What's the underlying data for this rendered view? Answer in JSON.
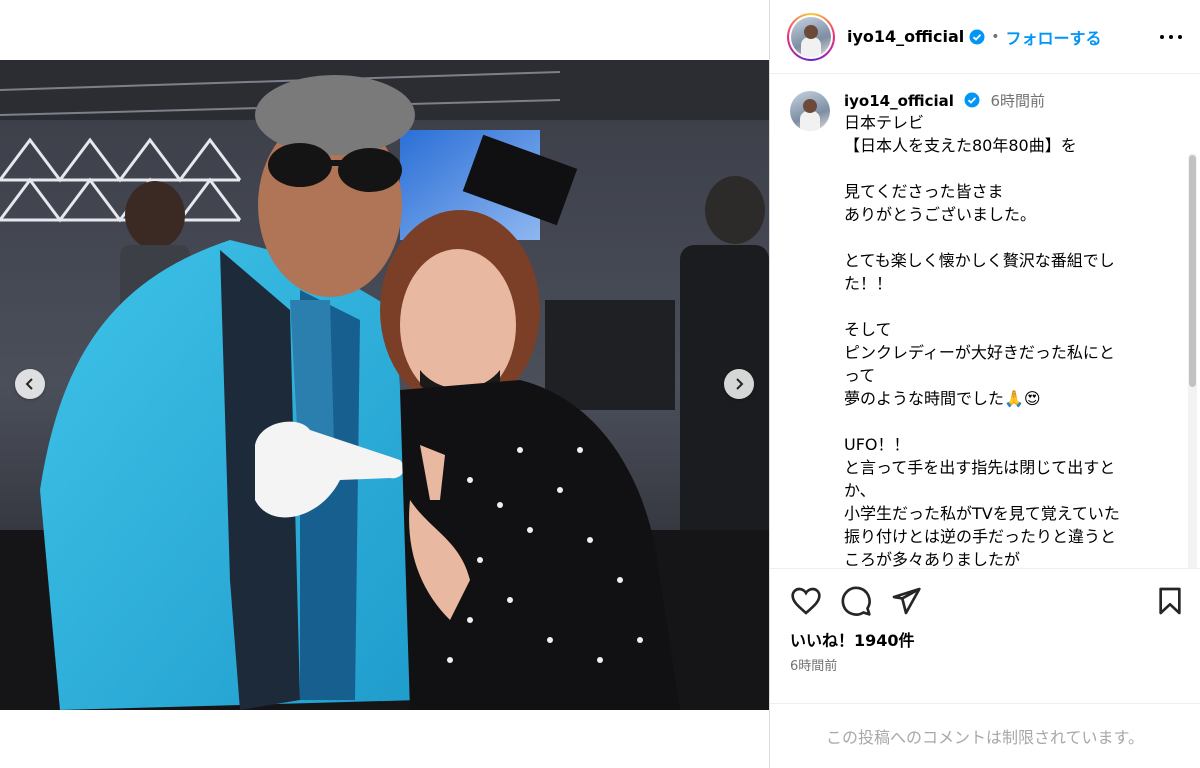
{
  "post": {
    "username": "iyo14_official",
    "follow_label": "フォローする",
    "separator": "•",
    "caption_time": "6時間前",
    "caption_lines": [
      "日本テレビ",
      "【日本人を支えた80年80曲】を",
      "",
      "見てくださった皆さま",
      "ありがとうございました。",
      "",
      "とても楽しく懐かしく贅沢な番組でし",
      "た！！",
      "",
      "そして",
      "ピンクレディーが大好きだった私にと",
      "って",
      "夢のような時間でした🙏😍",
      "",
      "UFO！！",
      "と言って手を出す指先は閉じて出すと",
      "か、",
      "小学生だった私がTVを見て覚えていた",
      "振り付けとは逆の手だったりと違うと",
      "ころが多々ありましたが"
    ],
    "likes_text": "いいね！1940件",
    "posted_time": "6時間前",
    "comments_restricted": "この投稿へのコメントは制限されています。"
  },
  "icons": {
    "verified": "verified-badge-icon",
    "more": "more-options-icon",
    "like": "heart-icon",
    "comment": "comment-icon",
    "share": "paper-plane-icon",
    "save": "bookmark-icon",
    "prev": "chevron-left-icon",
    "next": "chevron-right-icon"
  },
  "colors": {
    "link_blue": "#0095f6",
    "verified_blue": "#0095f6",
    "secondary_text": "#737373",
    "placeholder_text": "#a8a8a8"
  }
}
